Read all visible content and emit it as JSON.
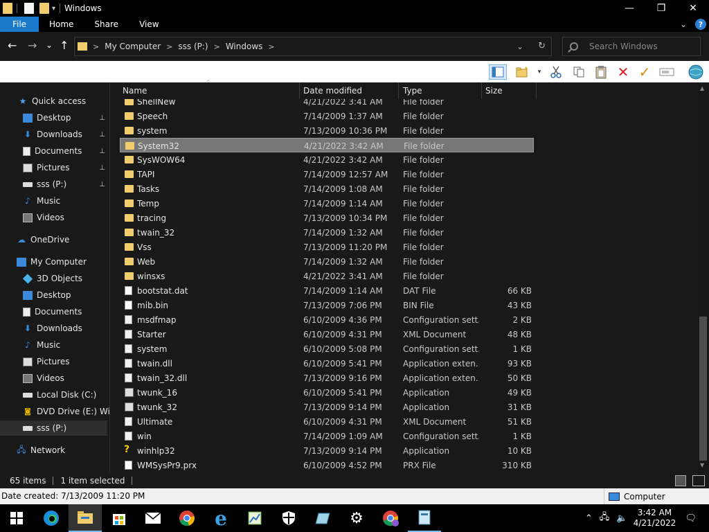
{
  "window": {
    "title": "Windows",
    "minimize": "—",
    "maximize": "❐",
    "close": "✕"
  },
  "ribbon": {
    "tabs": [
      "File",
      "Home",
      "Share",
      "View"
    ],
    "collapse": "⌄",
    "help": "?"
  },
  "nav": {
    "back": "←",
    "forward": "→",
    "recent": "⌄",
    "up": "↑"
  },
  "address": {
    "crumbs": [
      "My Computer",
      "sss (P:)",
      "Windows"
    ],
    "sep": ">",
    "dropdown": "⌄",
    "refresh": "↻"
  },
  "search": {
    "placeholder": "Search Windows"
  },
  "sidebar": {
    "items": [
      {
        "label": "Quick access",
        "icon": "star-icon"
      },
      {
        "label": "Desktop",
        "icon": "desktop-icon",
        "pinned": true
      },
      {
        "label": "Downloads",
        "icon": "download-icon",
        "pinned": true
      },
      {
        "label": "Documents",
        "icon": "document-icon",
        "pinned": true
      },
      {
        "label": "Pictures",
        "icon": "pictures-icon",
        "pinned": true
      },
      {
        "label": "sss (P:)",
        "icon": "drive-icon",
        "pinned": true
      },
      {
        "label": "Music",
        "icon": "music-icon"
      },
      {
        "label": "Videos",
        "icon": "video-icon"
      },
      {
        "label": "OneDrive",
        "icon": "cloud-icon"
      },
      {
        "label": "My Computer",
        "icon": "computer-icon"
      },
      {
        "label": "3D Objects",
        "icon": "cube-icon"
      },
      {
        "label": "Desktop",
        "icon": "desktop-icon"
      },
      {
        "label": "Documents",
        "icon": "document-icon"
      },
      {
        "label": "Downloads",
        "icon": "download-icon"
      },
      {
        "label": "Music",
        "icon": "music-icon"
      },
      {
        "label": "Pictures",
        "icon": "pictures-icon"
      },
      {
        "label": "Videos",
        "icon": "video-icon"
      },
      {
        "label": "Local Disk (C:)",
        "icon": "drive-icon"
      },
      {
        "label": "DVD Drive (E:) Wind",
        "icon": "dvd-icon"
      },
      {
        "label": "sss (P:)",
        "icon": "drive-icon",
        "selected": true
      },
      {
        "label": "Network",
        "icon": "network-icon"
      }
    ],
    "pin_glyph": "📌"
  },
  "columns": {
    "name": "Name",
    "date": "Date modified",
    "type": "Type",
    "size": "Size"
  },
  "files": [
    {
      "name": "ShellNew",
      "date": "4/21/2022 3:41 AM",
      "type": "File folder",
      "size": "",
      "kind": "folder"
    },
    {
      "name": "Speech",
      "date": "7/14/2009 1:37 AM",
      "type": "File folder",
      "size": "",
      "kind": "folder"
    },
    {
      "name": "system",
      "date": "7/13/2009 10:36 PM",
      "type": "File folder",
      "size": "",
      "kind": "folder"
    },
    {
      "name": "System32",
      "date": "4/21/2022 3:42 AM",
      "type": "File folder",
      "size": "",
      "kind": "folder",
      "selected": true
    },
    {
      "name": "SysWOW64",
      "date": "4/21/2022 3:42 AM",
      "type": "File folder",
      "size": "",
      "kind": "folder"
    },
    {
      "name": "TAPI",
      "date": "7/14/2009 12:57 AM",
      "type": "File folder",
      "size": "",
      "kind": "folder"
    },
    {
      "name": "Tasks",
      "date": "7/14/2009 1:08 AM",
      "type": "File folder",
      "size": "",
      "kind": "folder"
    },
    {
      "name": "Temp",
      "date": "7/14/2009 1:14 AM",
      "type": "File folder",
      "size": "",
      "kind": "folder"
    },
    {
      "name": "tracing",
      "date": "7/13/2009 10:34 PM",
      "type": "File folder",
      "size": "",
      "kind": "folder"
    },
    {
      "name": "twain_32",
      "date": "7/14/2009 1:32 AM",
      "type": "File folder",
      "size": "",
      "kind": "folder"
    },
    {
      "name": "Vss",
      "date": "7/13/2009 11:20 PM",
      "type": "File folder",
      "size": "",
      "kind": "folder"
    },
    {
      "name": "Web",
      "date": "7/14/2009 1:32 AM",
      "type": "File folder",
      "size": "",
      "kind": "folder"
    },
    {
      "name": "winsxs",
      "date": "4/21/2022 3:41 AM",
      "type": "File folder",
      "size": "",
      "kind": "folder"
    },
    {
      "name": "bootstat.dat",
      "date": "7/14/2009 1:14 AM",
      "type": "DAT File",
      "size": "66 KB",
      "kind": "file"
    },
    {
      "name": "mib.bin",
      "date": "7/13/2009 7:06 PM",
      "type": "BIN File",
      "size": "43 KB",
      "kind": "file"
    },
    {
      "name": "msdfmap",
      "date": "6/10/2009 4:36 PM",
      "type": "Configuration sett...",
      "size": "2 KB",
      "kind": "config"
    },
    {
      "name": "Starter",
      "date": "6/10/2009 4:31 PM",
      "type": "XML Document",
      "size": "48 KB",
      "kind": "config"
    },
    {
      "name": "system",
      "date": "6/10/2009 5:08 PM",
      "type": "Configuration sett...",
      "size": "1 KB",
      "kind": "config"
    },
    {
      "name": "twain.dll",
      "date": "6/10/2009 5:41 PM",
      "type": "Application exten...",
      "size": "93 KB",
      "kind": "config"
    },
    {
      "name": "twain_32.dll",
      "date": "7/13/2009 9:16 PM",
      "type": "Application exten...",
      "size": "50 KB",
      "kind": "config"
    },
    {
      "name": "twunk_16",
      "date": "6/10/2009 5:41 PM",
      "type": "Application",
      "size": "49 KB",
      "kind": "app"
    },
    {
      "name": "twunk_32",
      "date": "7/13/2009 9:14 PM",
      "type": "Application",
      "size": "31 KB",
      "kind": "app"
    },
    {
      "name": "Ultimate",
      "date": "6/10/2009 4:31 PM",
      "type": "XML Document",
      "size": "51 KB",
      "kind": "config"
    },
    {
      "name": "win",
      "date": "7/14/2009 1:09 AM",
      "type": "Configuration sett...",
      "size": "1 KB",
      "kind": "config"
    },
    {
      "name": "winhlp32",
      "date": "7/13/2009 9:14 PM",
      "type": "Application",
      "size": "10 KB",
      "kind": "help"
    },
    {
      "name": "WMSysPr9.prx",
      "date": "6/10/2009 4:52 PM",
      "type": "PRX File",
      "size": "310 KB",
      "kind": "file"
    }
  ],
  "status": {
    "count": "65 items",
    "selected": "1 item selected"
  },
  "details": {
    "created": "Date created: 7/13/2009 11:20 PM",
    "location": "Computer"
  },
  "taskbar": {
    "time": "3:42 AM",
    "date": "4/21/2022"
  },
  "colors": {
    "accent": "#1979ca",
    "folder": "#f2cd6e",
    "selection": "#777777"
  }
}
